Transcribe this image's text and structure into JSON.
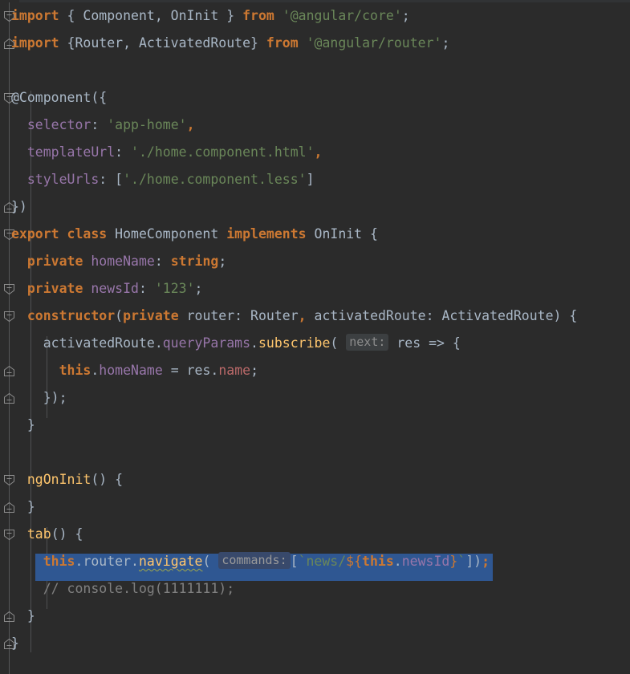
{
  "editor": {
    "language": "TypeScript",
    "theme": "Darcula",
    "colors": {
      "background": "#2b2b2b",
      "foreground": "#a9b7c6",
      "keyword": "#cc7832",
      "string": "#6a8759",
      "field": "#9876aa",
      "method": "#ffc66d",
      "comment": "#808080",
      "number": "#6897bb",
      "error": "#bc6a6a",
      "selection": "#2f5792",
      "gutter_line": "#555759",
      "indent_guide": "#4f5052",
      "hint_background": "#3c3f41",
      "hint_foreground": "#8c8c8c"
    },
    "inlay_hints": [
      {
        "label": "next:",
        "line": 12
      },
      {
        "label": "commands:",
        "line": 21
      }
    ],
    "selected_line_text": "this.router.navigate( [`news/${this.newsId}`]);",
    "fold_markers": [
      {
        "line": 1,
        "state": "expanded"
      },
      {
        "line": 2,
        "state": "end"
      },
      {
        "line": 4,
        "state": "expanded"
      },
      {
        "line": 8,
        "state": "end"
      },
      {
        "line": 9,
        "state": "expanded"
      },
      {
        "line": 11,
        "state": "expanded"
      },
      {
        "line": 12,
        "state": "expanded"
      },
      {
        "line": 14,
        "state": "end"
      },
      {
        "line": 15,
        "state": "end"
      },
      {
        "line": 18,
        "state": "expanded"
      },
      {
        "line": 19,
        "state": "end"
      },
      {
        "line": 20,
        "state": "expanded"
      },
      {
        "line": 23,
        "state": "end"
      },
      {
        "line": 24,
        "state": "end"
      }
    ],
    "lines": [
      {
        "n": 1,
        "tokens": [
          {
            "t": "import",
            "c": "kw"
          },
          {
            "t": " { Component, OnInit } ",
            "c": "plain"
          },
          {
            "t": "from",
            "c": "kw"
          },
          {
            "t": " ",
            "c": "plain"
          },
          {
            "t": "'@angular/core'",
            "c": "str"
          },
          {
            "t": ";",
            "c": "punct"
          }
        ]
      },
      {
        "n": 2,
        "tokens": [
          {
            "t": "import",
            "c": "kw"
          },
          {
            "t": " {Router, ActivatedRoute} ",
            "c": "plain"
          },
          {
            "t": "from",
            "c": "kw"
          },
          {
            "t": " ",
            "c": "plain"
          },
          {
            "t": "'@angular/router'",
            "c": "str"
          },
          {
            "t": ";",
            "c": "punct"
          }
        ]
      },
      {
        "n": 3,
        "tokens": []
      },
      {
        "n": 4,
        "tokens": [
          {
            "t": "@Component({",
            "c": "plain"
          }
        ]
      },
      {
        "n": 5,
        "tokens": [
          {
            "t": "  ",
            "c": "plain"
          },
          {
            "t": "selector",
            "c": "field"
          },
          {
            "t": ": ",
            "c": "punct"
          },
          {
            "t": "'app-home'",
            "c": "str"
          },
          {
            "t": ",",
            "c": "kw"
          }
        ]
      },
      {
        "n": 6,
        "tokens": [
          {
            "t": "  ",
            "c": "plain"
          },
          {
            "t": "templateUrl",
            "c": "field"
          },
          {
            "t": ": ",
            "c": "punct"
          },
          {
            "t": "'./home.component.html'",
            "c": "str"
          },
          {
            "t": ",",
            "c": "kw"
          }
        ]
      },
      {
        "n": 7,
        "tokens": [
          {
            "t": "  ",
            "c": "plain"
          },
          {
            "t": "styleUrls",
            "c": "field"
          },
          {
            "t": ": [",
            "c": "punct"
          },
          {
            "t": "'./home.component.less'",
            "c": "str"
          },
          {
            "t": "]",
            "c": "punct"
          }
        ]
      },
      {
        "n": 8,
        "tokens": [
          {
            "t": "})",
            "c": "plain"
          }
        ]
      },
      {
        "n": 9,
        "tokens": [
          {
            "t": "export class",
            "c": "kw"
          },
          {
            "t": " HomeComponent ",
            "c": "type"
          },
          {
            "t": "implements",
            "c": "kw"
          },
          {
            "t": " OnInit {",
            "c": "type"
          }
        ]
      },
      {
        "n": 10,
        "tokens": [
          {
            "t": "  ",
            "c": "plain"
          },
          {
            "t": "private",
            "c": "kw"
          },
          {
            "t": " ",
            "c": "plain"
          },
          {
            "t": "homeName",
            "c": "field"
          },
          {
            "t": ": ",
            "c": "punct"
          },
          {
            "t": "string",
            "c": "kw"
          },
          {
            "t": ";",
            "c": "punct"
          }
        ]
      },
      {
        "n": 11,
        "tokens": [
          {
            "t": "  ",
            "c": "plain"
          },
          {
            "t": "private",
            "c": "kw"
          },
          {
            "t": " ",
            "c": "plain"
          },
          {
            "t": "newsId",
            "c": "field"
          },
          {
            "t": ": ",
            "c": "punct"
          },
          {
            "t": "'123'",
            "c": "str"
          },
          {
            "t": ";",
            "c": "punct"
          }
        ]
      },
      {
        "n": 12,
        "tokens": [
          {
            "t": "  ",
            "c": "plain"
          },
          {
            "t": "constructor",
            "c": "kw"
          },
          {
            "t": "(",
            "c": "punct"
          },
          {
            "t": "private",
            "c": "kw"
          },
          {
            "t": " router: Router",
            "c": "plain"
          },
          {
            "t": ",",
            "c": "kw"
          },
          {
            "t": " activatedRoute: ActivatedRoute) {",
            "c": "plain"
          }
        ]
      },
      {
        "n": 13,
        "tokens": [
          {
            "t": "    activatedRoute",
            "c": "plain"
          },
          {
            "t": ".",
            "c": "punct"
          },
          {
            "t": "queryParams",
            "c": "field"
          },
          {
            "t": ".",
            "c": "punct"
          },
          {
            "t": "subscribe",
            "c": "method"
          },
          {
            "t": "( ",
            "c": "punct"
          },
          {
            "t": "@HINT:next:",
            "c": "hint"
          },
          {
            "t": " res => {",
            "c": "plain"
          }
        ]
      },
      {
        "n": 14,
        "tokens": [
          {
            "t": "      ",
            "c": "plain"
          },
          {
            "t": "this",
            "c": "kw"
          },
          {
            "t": ".",
            "c": "punct"
          },
          {
            "t": "homeName",
            "c": "field"
          },
          {
            "t": " = res",
            "c": "plain"
          },
          {
            "t": ".",
            "c": "punct"
          },
          {
            "t": "name",
            "c": "err"
          },
          {
            "t": ";",
            "c": "punct"
          }
        ]
      },
      {
        "n": 15,
        "tokens": [
          {
            "t": "    });",
            "c": "plain"
          }
        ]
      },
      {
        "n": 16,
        "tokens": [
          {
            "t": "  }",
            "c": "plain"
          }
        ]
      },
      {
        "n": 17,
        "tokens": []
      },
      {
        "n": 18,
        "tokens": [
          {
            "t": "  ",
            "c": "plain"
          },
          {
            "t": "ngOnInit",
            "c": "method"
          },
          {
            "t": "() {",
            "c": "punct"
          }
        ]
      },
      {
        "n": 19,
        "tokens": [
          {
            "t": "  }",
            "c": "plain"
          }
        ]
      },
      {
        "n": 20,
        "tokens": [
          {
            "t": "  ",
            "c": "plain"
          },
          {
            "t": "tab",
            "c": "method"
          },
          {
            "t": "() {",
            "c": "punct"
          }
        ]
      },
      {
        "n": 21,
        "tokens": [
          {
            "t": "    ",
            "c": "plain"
          },
          {
            "t": "this",
            "c": "kw"
          },
          {
            "t": ".",
            "c": "punct"
          },
          {
            "t": "router",
            "c": "plain"
          },
          {
            "t": ".",
            "c": "punct"
          },
          {
            "t": "navigate",
            "c": "method wavy"
          },
          {
            "t": "( ",
            "c": "punct"
          },
          {
            "t": "@HINT:commands:",
            "c": "hint-on-sel"
          },
          {
            "t": "[",
            "c": "punct"
          },
          {
            "t": "`news/",
            "c": "str"
          },
          {
            "t": "${",
            "c": "tmpl-brace"
          },
          {
            "t": "this",
            "c": "kw"
          },
          {
            "t": ".",
            "c": "punct"
          },
          {
            "t": "newsId",
            "c": "field"
          },
          {
            "t": "}",
            "c": "tmpl-brace"
          },
          {
            "t": "`",
            "c": "str"
          },
          {
            "t": "])",
            "c": "punct"
          },
          {
            "t": ";",
            "c": "kw"
          }
        ]
      },
      {
        "n": 22,
        "tokens": [
          {
            "t": "    // console.log(1111111);",
            "c": "comment"
          }
        ]
      },
      {
        "n": 23,
        "tokens": [
          {
            "t": "  }",
            "c": "plain"
          }
        ]
      },
      {
        "n": 24,
        "tokens": [
          {
            "t": "}",
            "c": "plain"
          }
        ]
      }
    ]
  }
}
